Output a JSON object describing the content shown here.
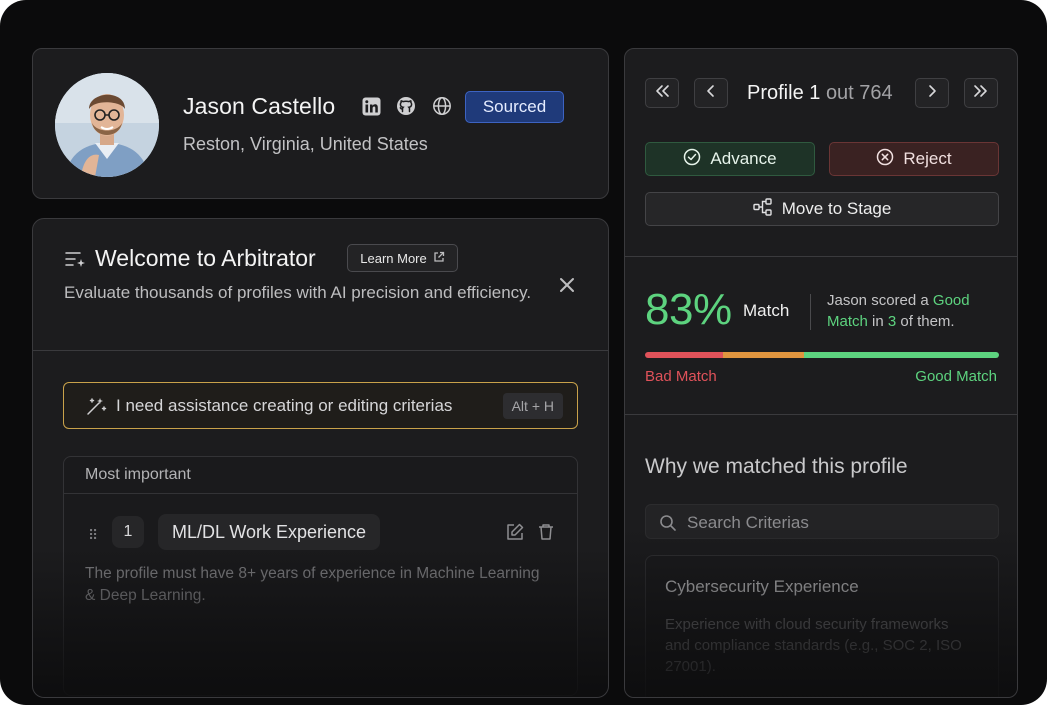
{
  "profile": {
    "name": "Jason Castello",
    "location": "Reston, Virginia, United States",
    "status_badge": "Sourced",
    "social_icons": [
      "linkedin-icon",
      "github-icon",
      "globe-icon"
    ]
  },
  "welcome": {
    "title": "Welcome to Arbitrator",
    "learn_more": "Learn More",
    "description": "Evaluate thousands of profiles with AI precision and efficiency.",
    "assist_text": "I need assistance creating or editing criterias",
    "assist_shortcut": "Alt + H"
  },
  "criteria": {
    "section_title": "Most important",
    "items": [
      {
        "number": "1",
        "title": "ML/DL Work Experience",
        "description": "The profile must have 8+ years of experience in Machine Learning & Deep Learning."
      }
    ]
  },
  "navigation": {
    "profile_label": "Profile 1",
    "profile_of": "out 764"
  },
  "actions": {
    "advance": "Advance",
    "reject": "Reject",
    "move_to_stage": "Move to Stage"
  },
  "match": {
    "percent": "83%",
    "label": "Match",
    "summary_prefix": "Jason scored a ",
    "summary_highlight": "Good Match",
    "summary_mid": " in ",
    "summary_count": "3",
    "summary_suffix": " of them.",
    "bad_label": "Bad Match",
    "good_label": "Good Match",
    "bar_segments": [
      {
        "color": "#e0525a",
        "fraction": 0.22
      },
      {
        "color": "#e0953f",
        "fraction": 0.23
      },
      {
        "color": "#5dd37f",
        "fraction": 0.55
      }
    ]
  },
  "why": {
    "title": "Why we matched this profile",
    "search_placeholder": "Search Criterias",
    "cards": [
      {
        "title": "Cybersecurity Experience",
        "description": "Experience with cloud security frameworks and compliance standards (e.g., SOC 2, ISO 27001)."
      }
    ]
  },
  "colors": {
    "background": "#0b0b0c",
    "panel": "#1c1c1e",
    "accent_green": "#5dd37f",
    "accent_red": "#e0525a",
    "badge_blue": "#1f3a7a",
    "assist_border": "#c9a24a"
  }
}
